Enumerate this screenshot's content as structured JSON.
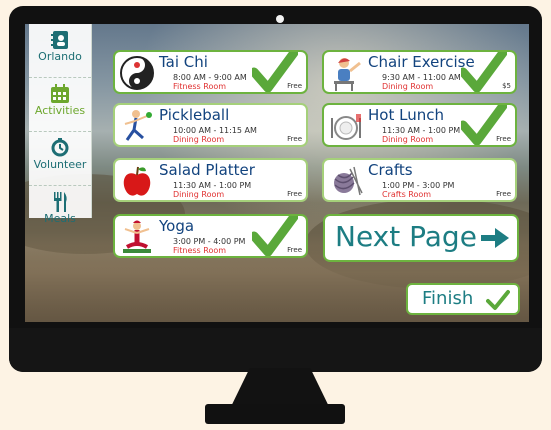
{
  "sidebar": {
    "items": [
      {
        "label": "Orlando",
        "icon": "contact-book-icon"
      },
      {
        "label": "Activities",
        "icon": "calendar-icon",
        "active": true
      },
      {
        "label": "Volunteer",
        "icon": "volunteer-icon"
      },
      {
        "label": "Meals",
        "icon": "fork-knife-icon"
      }
    ]
  },
  "activities": [
    {
      "title": "Tai Chi",
      "time": "8:00 AM - 9:00 AM",
      "room": "Fitness Room",
      "price": "Free",
      "selected": true
    },
    {
      "title": "Chair Exercise",
      "time": "9:30 AM - 11:00 AM",
      "room": "Dining Room",
      "price": "$5",
      "selected": true
    },
    {
      "title": "Pickleball",
      "time": "10:00 AM - 11:15 AM",
      "room": "Dining Room",
      "price": "Free",
      "selected": false
    },
    {
      "title": "Hot Lunch",
      "time": "11:30 AM - 1:00 PM",
      "room": "Dining Room",
      "price": "Free",
      "selected": true
    },
    {
      "title": "Salad Platter",
      "time": "11:30 AM - 1:00 PM",
      "room": "Dining Room",
      "price": "Free",
      "selected": false
    },
    {
      "title": "Crafts",
      "time": "1:00 PM - 3:00 PM",
      "room": "Crafts Room",
      "price": "Free",
      "selected": false
    },
    {
      "title": "Yoga",
      "time": "3:00 PM - 4:00 PM",
      "room": "Fitness Room",
      "price": "Free",
      "selected": true
    }
  ],
  "buttons": {
    "next": "Next Page",
    "finish": "Finish"
  },
  "colors": {
    "accent_green": "#6db33f",
    "teal": "#1d7d83",
    "title_blue": "#12437e",
    "room_red": "#e03131"
  }
}
